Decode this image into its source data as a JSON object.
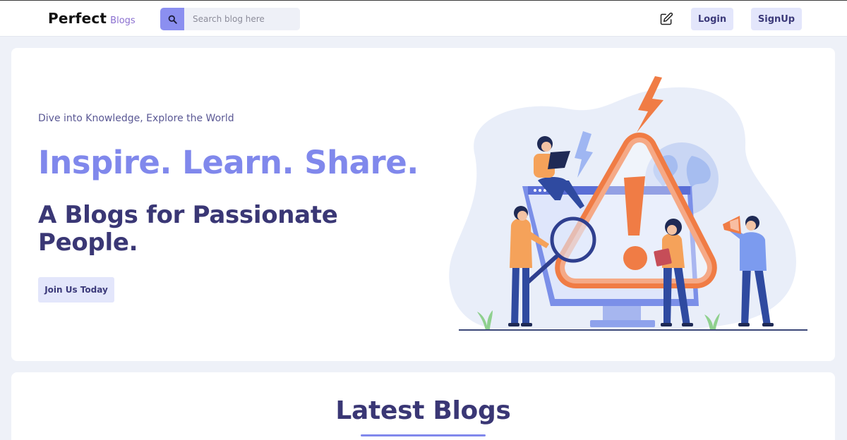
{
  "navbar": {
    "logo_main": "Perfect",
    "logo_sub": "Blogs",
    "search_placeholder": "Search blog here",
    "login_label": "Login",
    "signup_label": "SignUp"
  },
  "hero": {
    "tagline": "Dive into Knowledge, Explore the World",
    "headline": "Inspire. Learn. Share.",
    "subheadline": "A Blogs for Passionate People.",
    "cta_label": "Join Us Today"
  },
  "latest": {
    "title": "Latest Blogs"
  },
  "icons": {
    "search": "search-icon",
    "write": "edit-icon"
  },
  "colors": {
    "accent": "#8088ec",
    "primary_text": "#3a3775",
    "button_bg": "#e3e6fb",
    "warning_orange": "#f07c45",
    "page_bg": "#eef1f8"
  }
}
